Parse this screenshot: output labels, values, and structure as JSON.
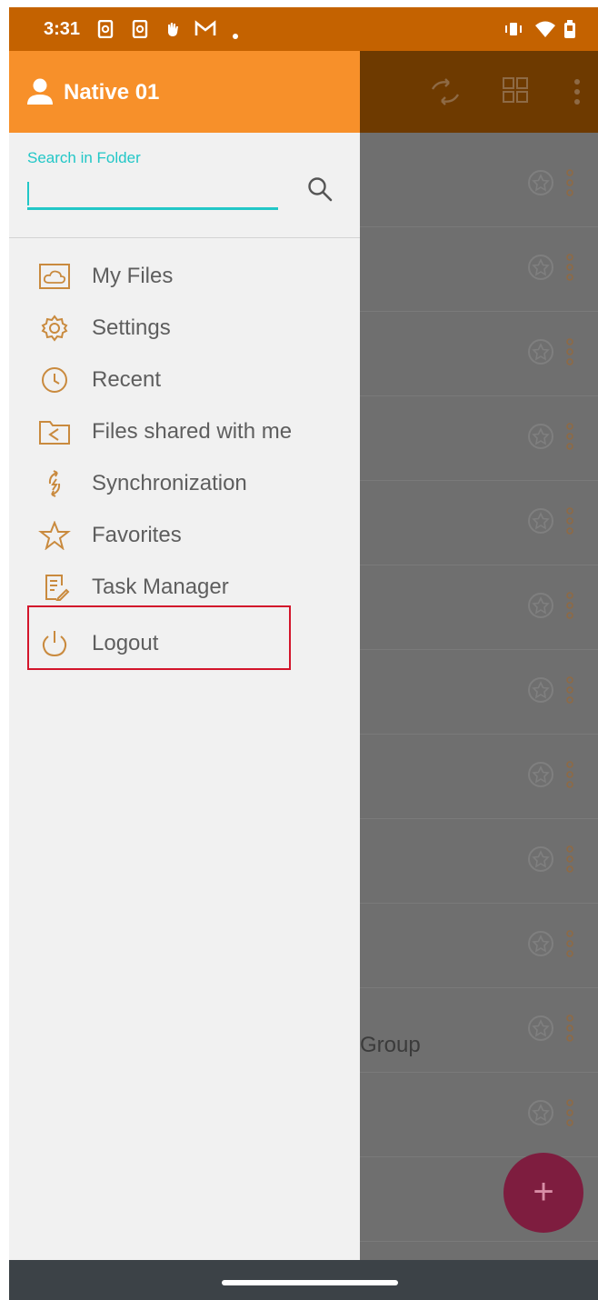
{
  "status_bar": {
    "time": "3:31",
    "icons": [
      "sim-card-icon",
      "sim-card-icon",
      "hand-icon",
      "gmail-icon",
      "dot-icon",
      "vibrate-icon",
      "wifi-icon",
      "battery-icon"
    ]
  },
  "drawer": {
    "user_name": "Native 01",
    "search": {
      "label": "Search in Folder",
      "value": "",
      "placeholder": ""
    },
    "menu": [
      {
        "label": "My Files",
        "icon": "folder-cloud-icon"
      },
      {
        "label": "Settings",
        "icon": "gear-icon"
      },
      {
        "label": "Recent",
        "icon": "clock-icon"
      },
      {
        "label": "Files shared with me",
        "icon": "shared-folder-icon"
      },
      {
        "label": "Synchronization",
        "icon": "sync-icon"
      },
      {
        "label": "Favorites",
        "icon": "star-icon"
      },
      {
        "label": "Task Manager",
        "icon": "task-list-icon"
      },
      {
        "label": "Logout",
        "icon": "power-icon"
      }
    ]
  },
  "background": {
    "toolbar_icons": [
      "sync-icon",
      "grid-view-icon",
      "more-vert-icon"
    ],
    "visible_text": "Group",
    "fab_label": "+"
  },
  "colors": {
    "status_bar": "#c46200",
    "drawer_header": "#f7902a",
    "accent": "#22c7c7",
    "icon_stroke": "#c98a3e",
    "highlight": "#d3152b",
    "fab": "#7e1d3f"
  }
}
